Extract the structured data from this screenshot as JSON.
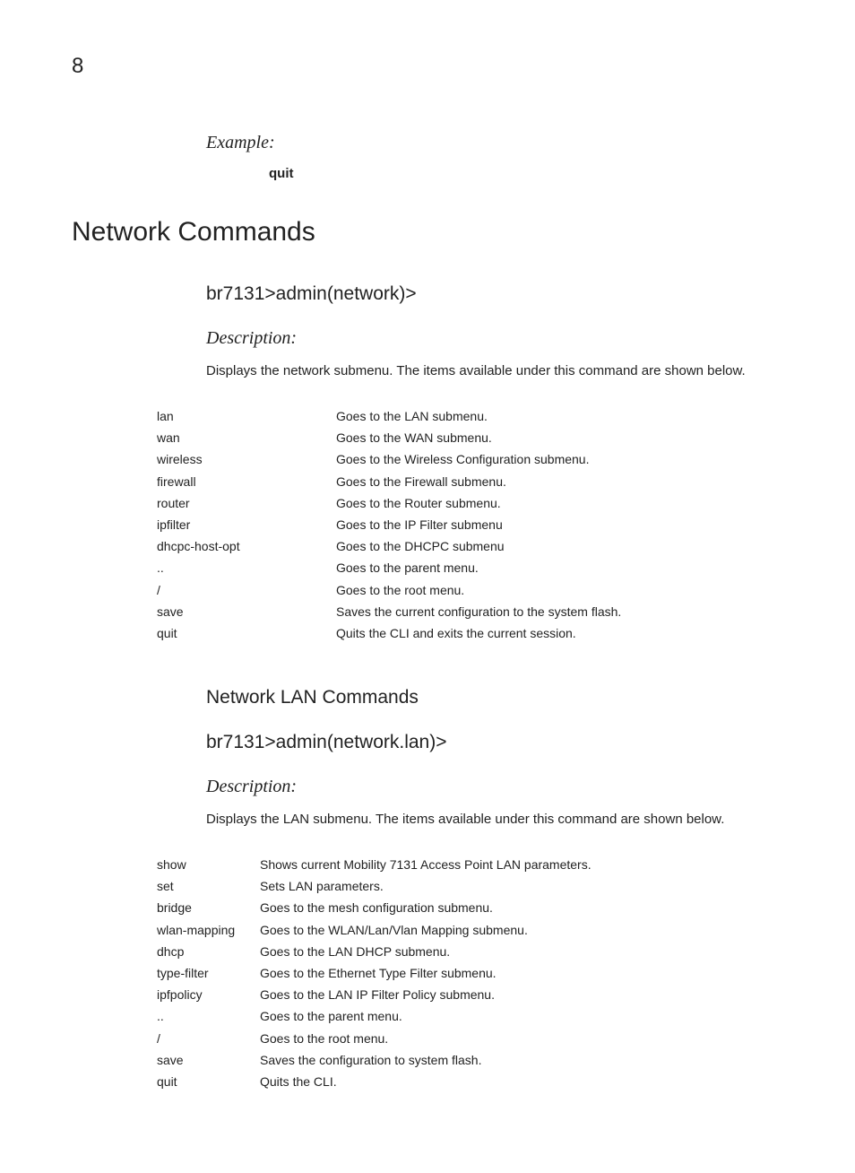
{
  "page_number": "8",
  "example_heading": "Example:",
  "example_code": "quit",
  "h1": "Network Commands",
  "section1": {
    "prompt": "br7131>admin(network)>",
    "desc_heading": "Description:",
    "desc_text": "Displays the network submenu. The items available under this command are shown below.",
    "rows": [
      {
        "cmd": "lan",
        "desc": "Goes to the LAN submenu."
      },
      {
        "cmd": "wan",
        "desc": "Goes to the WAN submenu."
      },
      {
        "cmd": "wireless",
        "desc": "Goes to the Wireless Configuration submenu."
      },
      {
        "cmd": "firewall",
        "desc": "Goes to the Firewall submenu."
      },
      {
        "cmd": "router",
        "desc": "Goes to the Router submenu."
      },
      {
        "cmd": "ipfilter",
        "desc": "Goes to the IP Filter submenu"
      },
      {
        "cmd": "dhcpc-host-opt",
        "desc": "Goes to the DHCPC submenu"
      },
      {
        "cmd": "..",
        "desc": "Goes to the parent menu."
      },
      {
        "cmd": "/",
        "desc": "Goes to the root menu."
      },
      {
        "cmd": "save",
        "desc": "Saves the current configuration to the system flash."
      },
      {
        "cmd": "quit",
        "desc": "Quits the CLI and exits the current session."
      }
    ]
  },
  "section2": {
    "subheading": "Network LAN Commands",
    "prompt": "br7131>admin(network.lan)>",
    "desc_heading": "Description:",
    "desc_text": "Displays the LAN submenu. The items available under this command are shown below.",
    "rows": [
      {
        "cmd": "show",
        "desc": "Shows current Mobility 7131 Access Point LAN parameters."
      },
      {
        "cmd": "set",
        "desc": "Sets LAN parameters."
      },
      {
        "cmd": "bridge",
        "desc": "Goes to the mesh configuration submenu."
      },
      {
        "cmd": "wlan-mapping",
        "desc": "Goes to the WLAN/Lan/Vlan Mapping submenu."
      },
      {
        "cmd": "dhcp",
        "desc": "Goes to the LAN DHCP submenu."
      },
      {
        "cmd": "type-filter",
        "desc": "Goes to the Ethernet Type Filter submenu."
      },
      {
        "cmd": "ipfpolicy",
        "desc": "Goes to the LAN IP Filter Policy submenu."
      },
      {
        "cmd": "..",
        "desc": "Goes to the parent menu."
      },
      {
        "cmd": "/",
        "desc": "Goes to the root menu."
      },
      {
        "cmd": "save",
        "desc": "Saves the configuration to system flash."
      },
      {
        "cmd": "quit",
        "desc": "Quits the CLI."
      }
    ]
  }
}
